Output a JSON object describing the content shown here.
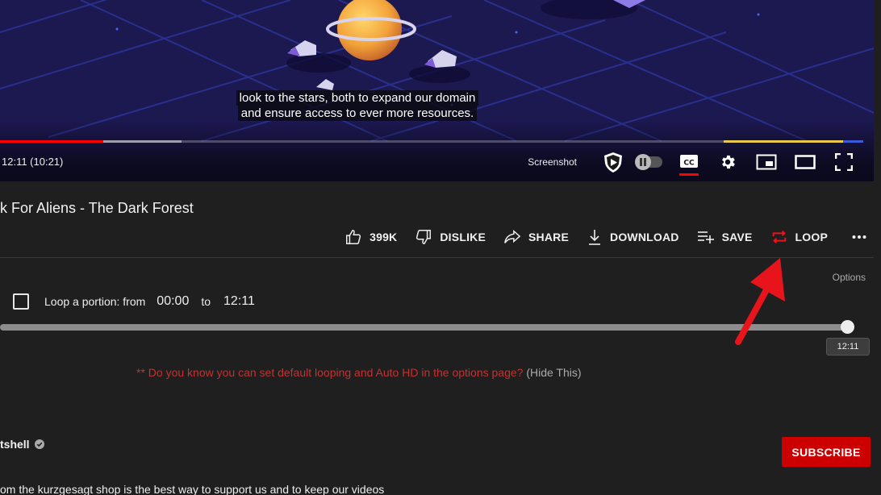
{
  "video": {
    "subtitle_lines": [
      "look to the stars, both to expand our domain",
      "and ensure access to ever more resources."
    ],
    "progress": {
      "played_fraction": 0.12,
      "buffered_fraction": 0.21,
      "loop_marker_start_fraction": 0.838,
      "loop_marker_end_fraction": 0.977
    },
    "time_display": "12:11 (10:21)",
    "controls": {
      "screenshot_label": "Screenshot",
      "icons": [
        "shield-play-icon",
        "autoplay-toggle",
        "captions-icon",
        "settings-gear-icon",
        "miniplayer-icon",
        "theater-mode-icon",
        "fullscreen-icon"
      ]
    }
  },
  "title": "k For Aliens - The Dark Forest",
  "actions": {
    "like_count": "399K",
    "dislike": "DISLIKE",
    "share": "SHARE",
    "download": "DOWNLOAD",
    "save": "SAVE",
    "loop": "LOOP"
  },
  "loop_panel": {
    "options": "Options",
    "label": "Loop a portion: from",
    "from": "00:00",
    "to_label": "to",
    "to": "12:11",
    "slider_value": 1.0,
    "slider_tooltip": "12:11",
    "tip": "** Do you know you can set default looping and Auto HD in the options page?",
    "hide": "(Hide This)"
  },
  "channel": {
    "name": "tshell",
    "subscribe": "SUBSCRIBE",
    "description": "om the kurzgesagt shop is the best way to support us and to keep our videos"
  },
  "colors": {
    "accent_red": "#cc0000",
    "progress_red": "#ff0000",
    "annotation_arrow": "#e8141c",
    "tip_text": "#c33232",
    "background": "#1f1f1f"
  }
}
